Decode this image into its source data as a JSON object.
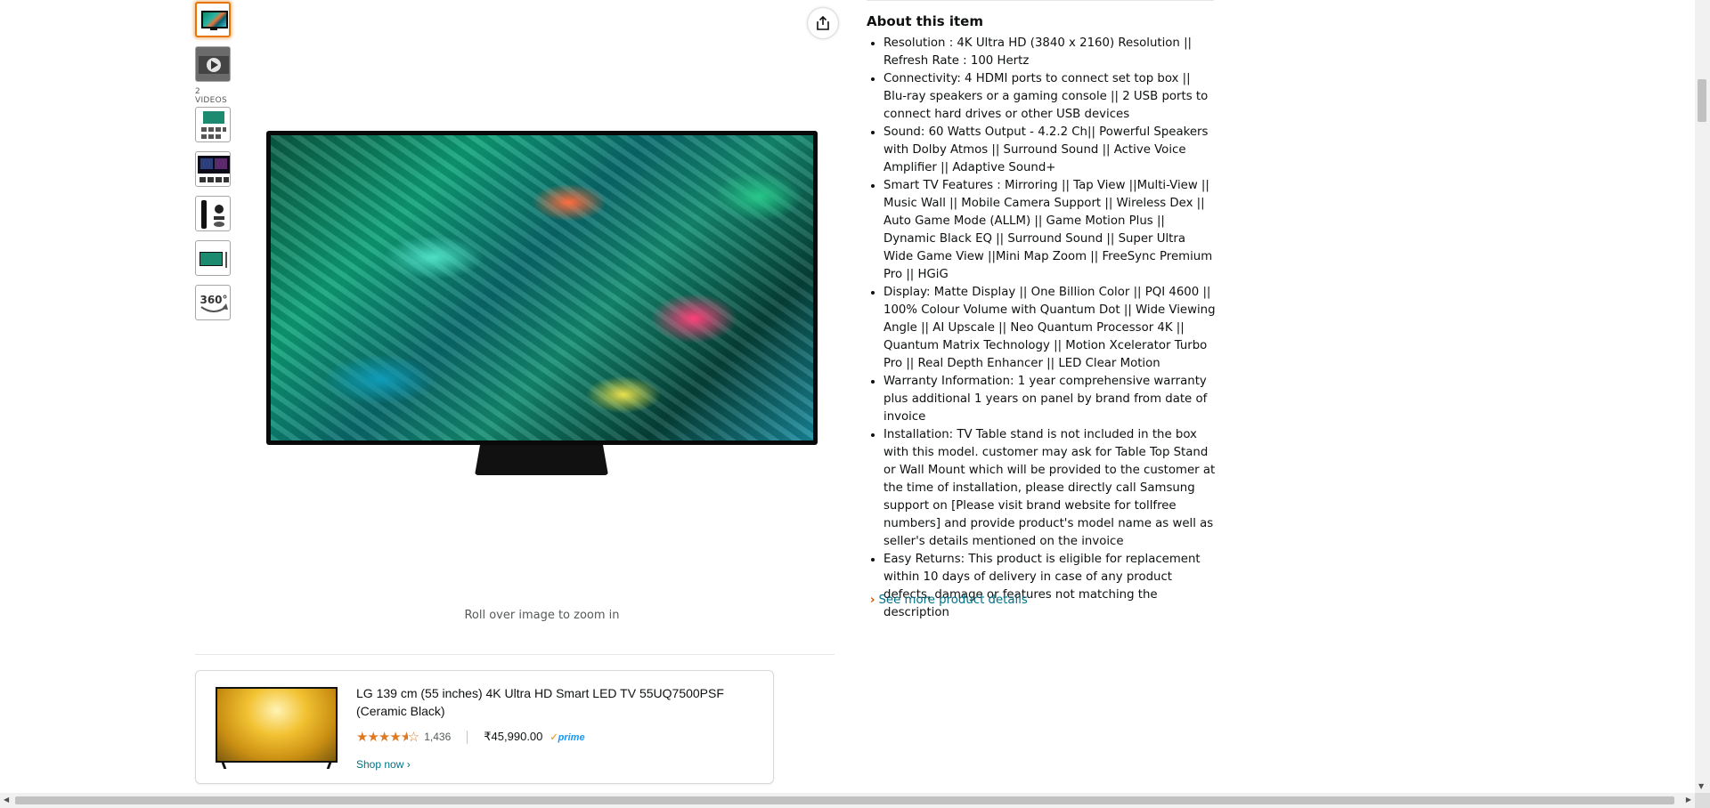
{
  "thumbnails": {
    "videos_label": "2 VIDEOS",
    "items": [
      "tv-front",
      "video",
      "features-chart",
      "remote-panel",
      "remote-accessories",
      "tv-side",
      "360-view"
    ],
    "view360_label": "360°"
  },
  "main_image": {
    "zoom_hint": "Roll over image to zoom in"
  },
  "about": {
    "heading": "About this item",
    "bullets": [
      "Resolution : 4K Ultra HD (3840 x 2160) Resolution || Refresh Rate : 100 Hertz",
      "Connectivity: 4 HDMI ports to connect set top box || Blu-ray speakers or a gaming console || 2 USB ports to connect hard drives or other USB devices",
      "Sound: 60 Watts Output - 4.2.2 Ch|| Powerful Speakers with Dolby Atmos || Surround Sound || Active Voice Amplifier || Adaptive Sound+",
      "Smart TV Features : Mirroring || Tap View ||Multi-View || Music Wall || Mobile Camera Support || Wireless Dex || Auto Game Mode (ALLM) || Game Motion Plus || Dynamic Black EQ || Surround Sound || Super Ultra Wide Game View ||Mini Map Zoom || FreeSync Premium Pro || HGiG",
      "Display: Matte Display || One Billion Color || PQI 4600 || 100% Colour Volume with Quantum Dot || Wide Viewing Angle || AI Upscale || Neo Quantum Processor 4K || Quantum Matrix Technology || Motion Xcelerator Turbo Pro || Real Depth Enhancer || LED Clear Motion",
      "Warranty Information: 1 year comprehensive warranty plus additional 1 years on panel by brand from date of invoice",
      "Installation: TV Table stand is not included in the box with this model. customer may ask for Table Top Stand or Wall Mount which will be provided to the customer at the time of installation, please directly call Samsung support on [Please visit brand website for tollfree numbers] and provide product's model name as well as seller's details mentioned on the invoice",
      "Easy Returns: This product is eligible for replacement within 10 days of delivery in case of any product defects, damage or features not matching the description"
    ],
    "see_more": "See more product details"
  },
  "sponsored": {
    "title": "LG 139 cm (55 inches) 4K Ultra HD Smart LED TV 55UQ7500PSF (Ceramic Black)",
    "rating": 4.5,
    "review_count": "1,436",
    "price": "₹45,990.00",
    "prime_label": "prime",
    "shop_now": "Shop now ›"
  },
  "colors": {
    "link": "#007185",
    "star": "#de7921",
    "active_thumb": "#e77600",
    "prime": "#1399ff"
  }
}
